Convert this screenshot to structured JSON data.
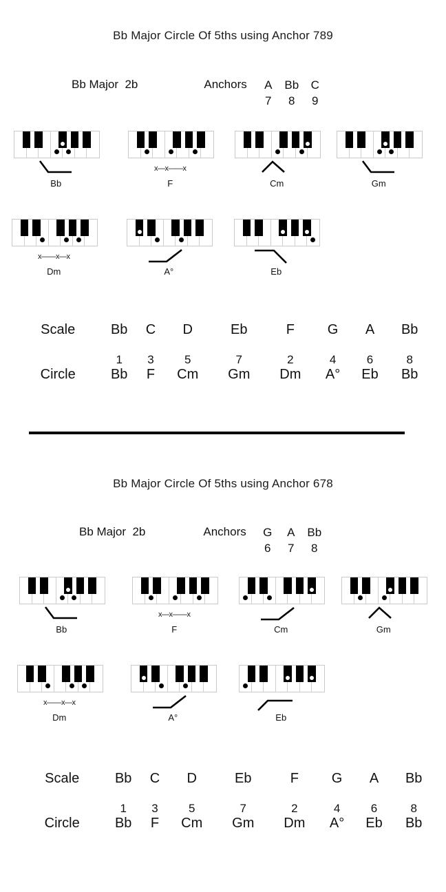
{
  "sections": [
    {
      "id": "anchor-789",
      "title": "Bb Major Circle Of 5ths using Anchor 789",
      "key_label": "Bb Major  2b",
      "anchors_label": "Anchors",
      "anchors": [
        {
          "note": "A",
          "num": "7"
        },
        {
          "note": "Bb",
          "num": "8"
        },
        {
          "note": "C",
          "num": "9"
        }
      ],
      "chords": [
        {
          "name": "Bb",
          "glyph": "down-hook",
          "glyph_text": "",
          "white_dots": [
            3,
            4
          ],
          "black_dot": 2
        },
        {
          "name": "F",
          "glyph": "x-line",
          "glyph_text": "x—x——x",
          "white_dots": [
            1,
            3,
            5
          ],
          "black_dot": null
        },
        {
          "name": "Cm",
          "glyph": "caret",
          "glyph_text": "",
          "white_dots": [
            3,
            5
          ],
          "black_dot": 4
        },
        {
          "name": "Gm",
          "glyph": "down-hook",
          "glyph_text": "",
          "white_dots": [
            3,
            4
          ],
          "black_dot": 2
        }
      ],
      "chords_row2": [
        {
          "name": "Dm",
          "glyph": "x-line",
          "glyph_text": "x——x—x",
          "white_dots": [
            2,
            4,
            5
          ],
          "black_dot": null
        },
        {
          "name": "A°",
          "glyph": "rise",
          "glyph_text": "",
          "white_dots": [
            2,
            4
          ],
          "black_dot": 5
        },
        {
          "name": "Eb",
          "glyph": "fall",
          "glyph_text": "",
          "white_dots": [
            6
          ],
          "black_dot": null,
          "black_dots2": [
            2,
            4
          ]
        }
      ],
      "table": {
        "scale_label": "Scale",
        "circle_label": "Circle",
        "scale": [
          "Bb",
          "C",
          "D",
          "Eb",
          "F",
          "G",
          "A",
          "Bb"
        ],
        "degrees": [
          "1",
          "3",
          "5",
          "7",
          "2",
          "4",
          "6",
          "8"
        ],
        "circle": [
          "Bb",
          "F",
          "Cm",
          "Gm",
          "Dm",
          "A°",
          "Eb",
          "Bb"
        ]
      }
    },
    {
      "id": "anchor-678",
      "title": "Bb Major Circle Of 5ths using Anchor 678",
      "key_label": "Bb Major  2b",
      "anchors_label": "Anchors",
      "anchors": [
        {
          "note": "G",
          "num": "6"
        },
        {
          "note": "A",
          "num": "7"
        },
        {
          "note": "Bb",
          "num": "8"
        }
      ],
      "chords": [
        {
          "name": "Bb",
          "glyph": "down-hook",
          "glyph_text": "",
          "white_dots": [
            3,
            4
          ],
          "black_dot": 2
        },
        {
          "name": "F",
          "glyph": "x-line",
          "glyph_text": "x—x——x",
          "white_dots": [
            1,
            3,
            5
          ],
          "black_dot": null
        },
        {
          "name": "Cm",
          "glyph": "rise",
          "glyph_text": "",
          "white_dots": [
            0,
            2
          ],
          "black_dot": 4
        },
        {
          "name": "Gm",
          "glyph": "caret",
          "glyph_text": "",
          "white_dots": [
            1,
            3
          ],
          "black_dot": 2
        }
      ],
      "chords_row2": [
        {
          "name": "Dm",
          "glyph": "x-line",
          "glyph_text": "x——x—x",
          "white_dots": [
            2,
            4,
            5
          ],
          "black_dot": null
        },
        {
          "name": "A°",
          "glyph": "rise",
          "glyph_text": "",
          "white_dots": [
            2,
            4
          ],
          "black_dot": 5
        },
        {
          "name": "Eb",
          "glyph": "rise-flat",
          "glyph_text": "",
          "white_dots": [
            0
          ],
          "black_dot": null,
          "black_dots2": [
            2,
            4
          ]
        }
      ],
      "table": {
        "scale_label": "Scale",
        "circle_label": "Circle",
        "scale": [
          "Bb",
          "C",
          "D",
          "Eb",
          "F",
          "G",
          "A",
          "Bb"
        ],
        "degrees": [
          "1",
          "3",
          "5",
          "7",
          "2",
          "4",
          "6",
          "8"
        ],
        "circle": [
          "Bb",
          "F",
          "Cm",
          "Gm",
          "Dm",
          "A°",
          "Eb",
          "Bb"
        ]
      }
    }
  ],
  "colors": {
    "ink": "#111111",
    "key_black": "#000000",
    "key_white": "#ffffff",
    "key_border": "#c9c9c9",
    "divider": "#000000"
  }
}
